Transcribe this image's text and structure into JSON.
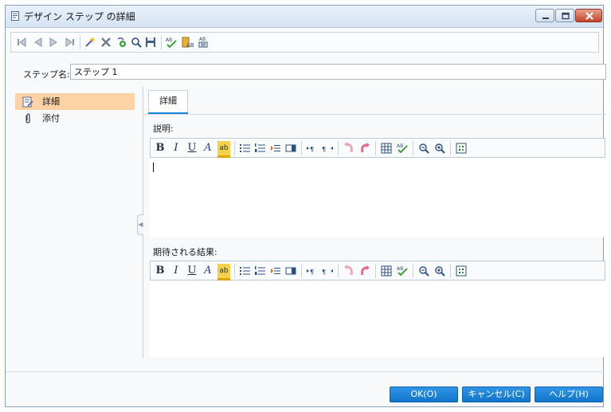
{
  "window": {
    "title": "デザイン ステップ の詳細",
    "titlebar_buttons": [
      "minimize-icon",
      "maximize-icon",
      "close-icon"
    ]
  },
  "toolbar": {
    "icons": [
      "first-record-icon",
      "previous-record-icon",
      "next-record-icon",
      "last-record-icon",
      "new-step-icon",
      "delete-icon",
      "copy-step-icon",
      "find-icon",
      "save-icon",
      "spell-check-icon",
      "parameter-icon",
      "generate-script-icon"
    ]
  },
  "step_name": {
    "label": "ステップ名:",
    "value": "ステップ 1"
  },
  "nav": {
    "items": [
      {
        "label": "詳細",
        "icon": "details-icon",
        "selected": true
      },
      {
        "label": "添付",
        "icon": "paperclip-icon",
        "selected": false
      }
    ]
  },
  "tabs": [
    {
      "label": "詳細",
      "active": true
    }
  ],
  "description": {
    "label": "説明:",
    "value": ""
  },
  "expected": {
    "label": "期待される結果:",
    "value": ""
  },
  "editor_toolbar": {
    "bold": "B",
    "italic": "I",
    "underline": "U",
    "font_color": "A",
    "highlight": "ab"
  },
  "buttons": {
    "ok": "OK(O)",
    "cancel": "キャンセル(C)",
    "help": "ヘルプ(H)"
  },
  "colors": {
    "accent": "#1c86d9",
    "selected_nav": "#fdd3a6",
    "button": "#1a80d4"
  }
}
